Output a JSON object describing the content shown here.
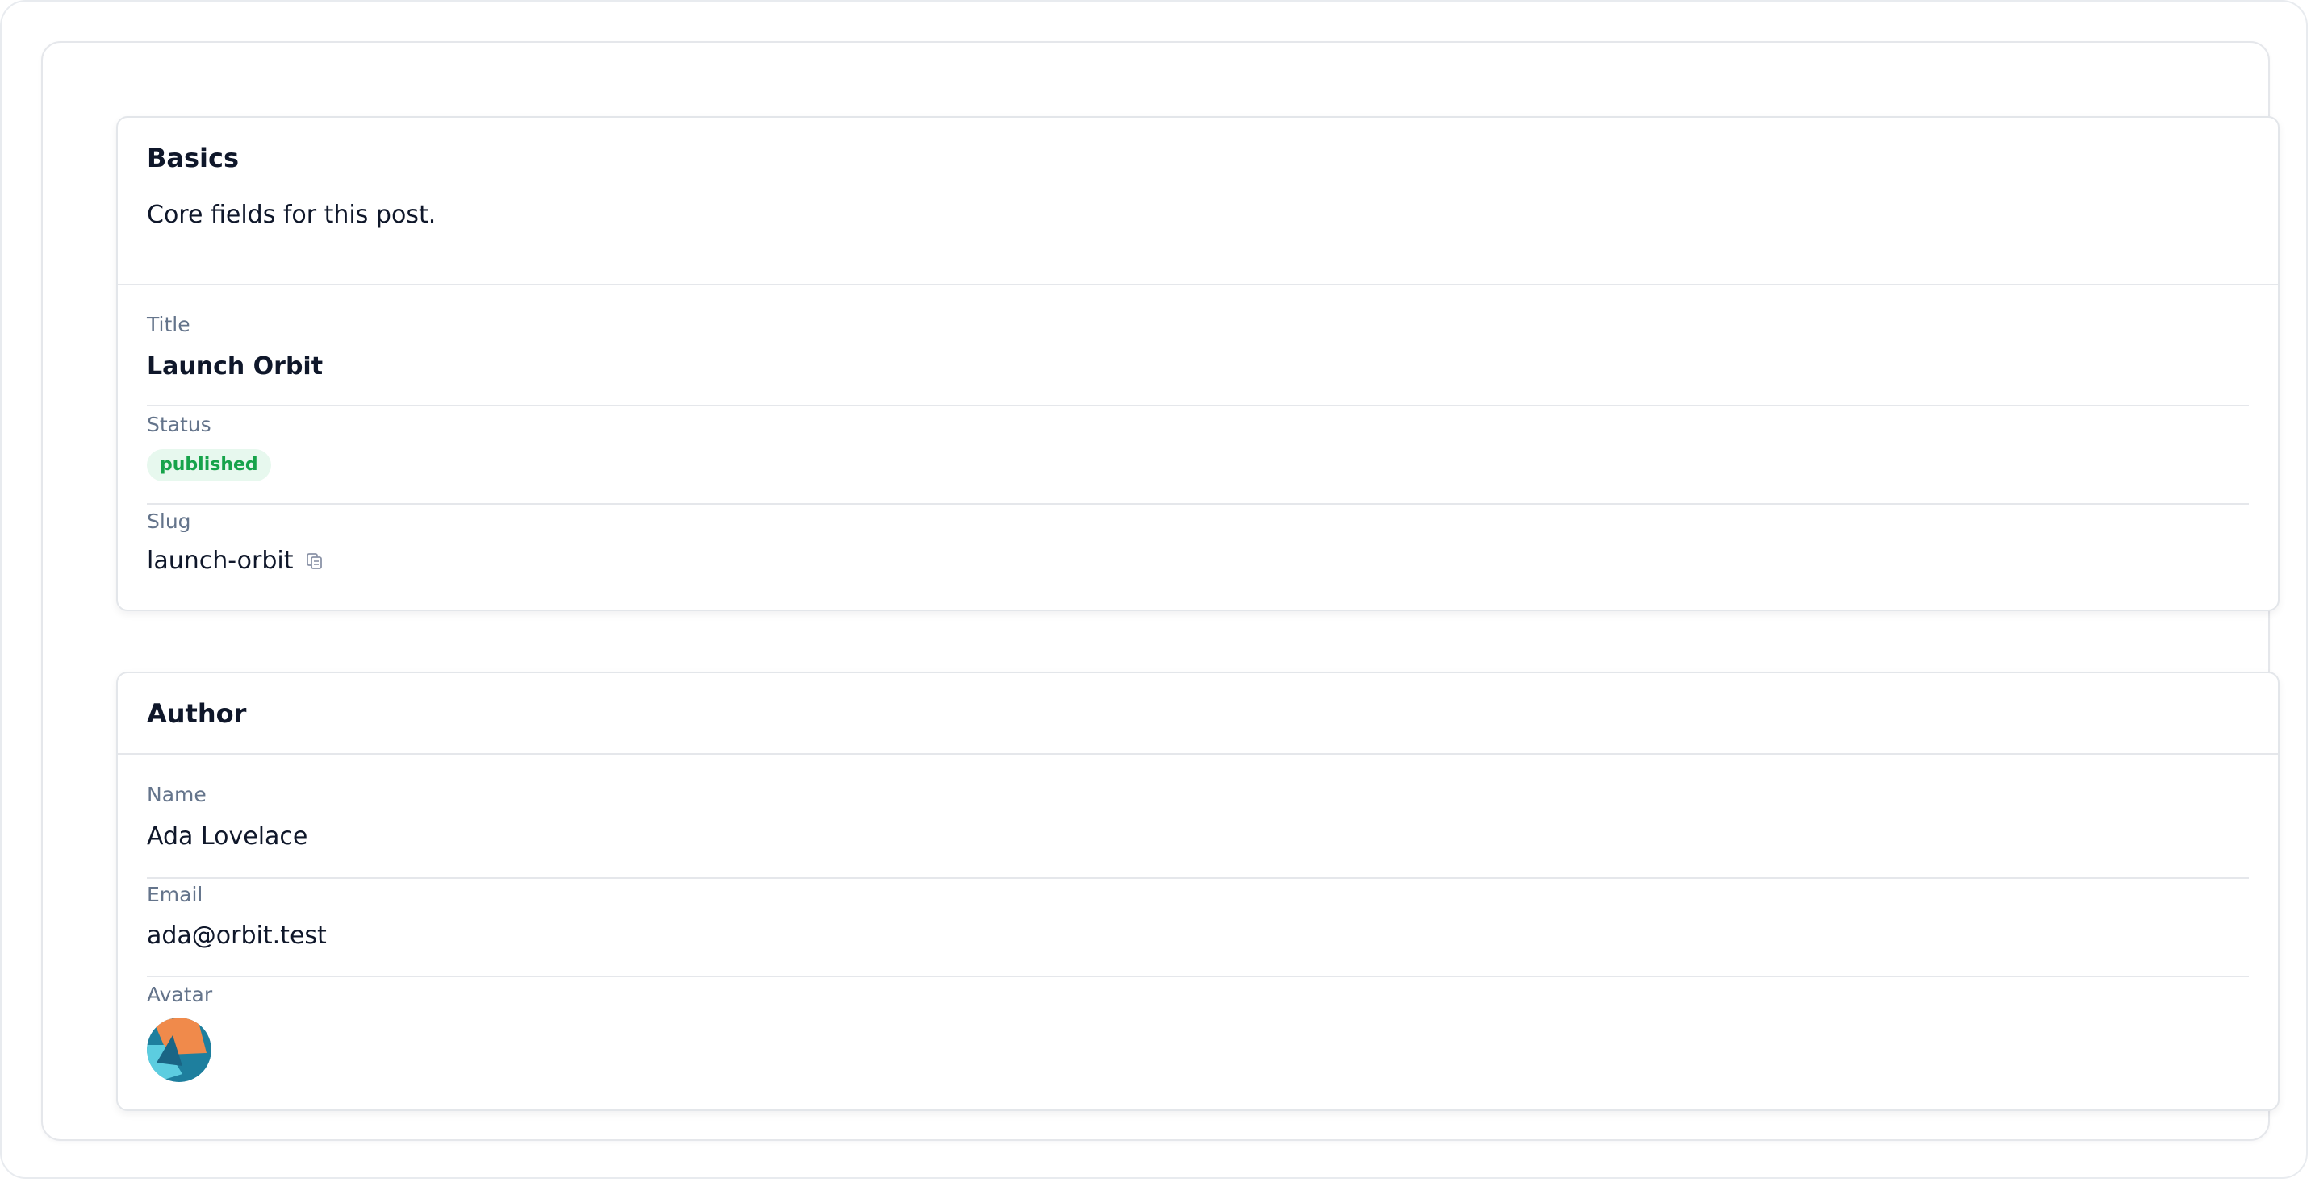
{
  "basics": {
    "title": "Basics",
    "description": "Core fields for this post.",
    "fields": {
      "title": {
        "label": "Title",
        "value": "Launch Orbit"
      },
      "status": {
        "label": "Status",
        "value": "published",
        "color": "#16a34a",
        "background": "#e7f8ee"
      },
      "slug": {
        "label": "Slug",
        "value": "launch-orbit",
        "icon": "copy-icon"
      }
    }
  },
  "author": {
    "title": "Author",
    "fields": {
      "name": {
        "label": "Name",
        "value": "Ada Lovelace"
      },
      "email": {
        "label": "Email",
        "value": "ada@orbit.test"
      },
      "avatar": {
        "label": "Avatar",
        "colors": [
          "#1e7f9e",
          "#f08a4b",
          "#5ccde0"
        ]
      }
    }
  }
}
